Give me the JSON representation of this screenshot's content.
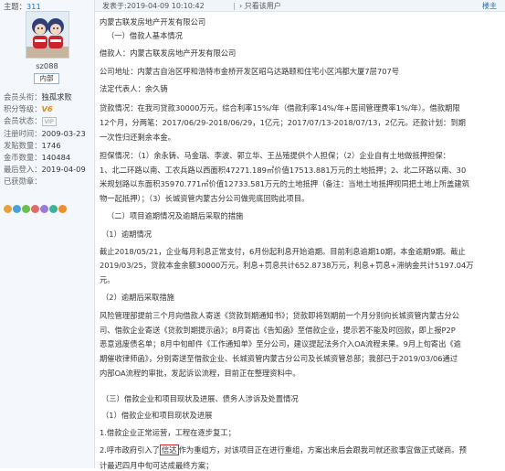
{
  "sidebar": {
    "topic_count_label": "主题：",
    "topic_count_value": "311",
    "username": "sz088",
    "role": "内部",
    "meta": [
      {
        "k": "会员头衔：",
        "v": "独孤求败"
      },
      {
        "k": "积分等级：",
        "v": "V6"
      },
      {
        "k": "会员状态：",
        "v": "VIP"
      },
      {
        "k": "注册时间：",
        "v": "2009-03-23"
      },
      {
        "k": "发贴数量：",
        "v": "1746"
      },
      {
        "k": "金币数量：",
        "v": "140484"
      },
      {
        "k": "最后登入：",
        "v": "2019-04-09"
      },
      {
        "k": "已获勋章：",
        "v": ""
      }
    ],
    "medal_colors": [
      "#e8a23a",
      "#4aa3d8",
      "#6cbf4a",
      "#e06a6a",
      "#9b7ad6",
      "#3ab39a",
      "#f08a2b"
    ]
  },
  "post": {
    "time": "发表于:2019-04-09 10:10:42",
    "sep": "|",
    "only_author": "只看该用户",
    "floor": "楼主"
  },
  "content_lines": [
    "内蒙古联发房地产开发有限公司",
    "（一）借款人基本情况",
    "借款人：内蒙古联发房地产开发有限公司",
    "公司地址：内蒙古自治区呼和浩特市金桥开发区昭乌达路颐和住宅小区鸿都大厦7层707号",
    "法定代表人：余久铸",
    "贷款情况：在我司贷款30000万元，综合利率15%/年（借款利率14%/年+居间管理费率1%/年）。借款期限",
    "12个月，分两笔：2017/06/29-2018/06/29，1亿元；2017/07/13-2018/07/13，2亿元。还款计划：到期",
    "一次性归还剩余本金。",
    "担保情况：（1）余永铸、马金瑞、李波、郭立华、王丛殖提供个人担保；（2）企业自有土地做抵押担保：",
    "1、北二环路以南、工农兵路以西面积47271.189㎡价值17513.881万元的土地抵押；2、北二环路以南、30",
    "米规划路以东面积35970.771㎡价值12733.581万元的土地抵押（备注：当地土地抵押视同把土地上所盖建筑",
    "物一起抵押）；（3）长城资管内蒙古分公司做兜底回购此项目。",
    "（二）项目逾期情况及逾期后采取的措施",
    "（1）逾期情况",
    "截止2018/05/21，企业每月利息正常支付，6月份起利息开始逾期。目前利息逾期10期，本金逾期9期。截止",
    "2019/03/25，贷款本金余额30000万元，利息+罚息共计652.8738万元，利息+罚息+滞纳金共计5197.04万",
    "元。",
    "（2）逾期后采取措施",
    "风险管理部提前三个月向借款人寄送《贷款到期通知书》；贷款即将到期前一个月分别向长城资管内蒙古分公",
    "司、借款企业寄送《贷款到期提示函》；8月寄出《告知函》至借款企业，提示若不能及时回款，即上报P2P",
    "恶意逃废债名单；8月中旬邮件《工作通知单》至分公司，建议提起法务介入OA流程未果。9月上旬寄出《逾",
    "期催收律师函》，分别寄送至借款企业、长城资管内蒙古分公司及长城资管总部；我部已于2019/03/06通过",
    "内部OA流程的审批，发起诉讼流程，目前正在整理资料中。",
    "（三）借款企业和项目现状及进展、债务人涉诉及处置情况",
    "（1）借款企业和项目现状及进展",
    "1.借款企业正常运营，工程在逐步复工；",
    "2.呼市政府引入了",
    "信达",
    "作为重组方，对该项目正在进行重组，方案出来后会跟我司就还款事宜做正式磋商。预",
    "计最迟四月中旬可达成最终方案；"
  ]
}
